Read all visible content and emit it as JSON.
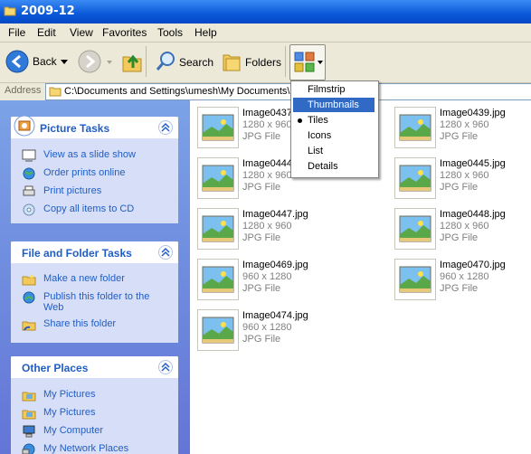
{
  "window": {
    "title": "2009-12"
  },
  "menubar": [
    "File",
    "Edit",
    "View",
    "Favorites",
    "Tools",
    "Help"
  ],
  "toolbar": {
    "back": "Back",
    "search": "Search",
    "folders": "Folders"
  },
  "address": {
    "label": "Address",
    "value": "C:\\Documents and Settings\\umesh\\My Documents\\My"
  },
  "views_menu": {
    "items": [
      "Filmstrip",
      "Thumbnails",
      "Tiles",
      "Icons",
      "List",
      "Details"
    ],
    "highlighted": "Thumbnails",
    "checked": "Tiles"
  },
  "tasks": {
    "picture": {
      "title": "Picture Tasks",
      "items": [
        "View as a slide show",
        "Order prints online",
        "Print pictures",
        "Copy all items to CD"
      ]
    },
    "folder": {
      "title": "File and Folder Tasks",
      "items": [
        "Make a new folder",
        "Publish this folder to the",
        "Web",
        "Share this folder"
      ]
    },
    "places": {
      "title": "Other Places",
      "items": [
        "My Pictures",
        "My Pictures",
        "My Computer",
        "My Network Places"
      ]
    }
  },
  "files": [
    {
      "name": "Image0437.jpg",
      "dim": "1280 x 960",
      "type": "JPG File"
    },
    {
      "name": "Image0439.jpg",
      "dim": "1280 x 960",
      "type": "JPG File"
    },
    {
      "name": "Image0444.jpg",
      "dim": "1280 x 960",
      "type": "JPG File"
    },
    {
      "name": "Image0445.jpg",
      "dim": "1280 x 960",
      "type": "JPG File"
    },
    {
      "name": "Image0447.jpg",
      "dim": "1280 x 960",
      "type": "JPG File"
    },
    {
      "name": "Image0448.jpg",
      "dim": "1280 x 960",
      "type": "JPG File"
    },
    {
      "name": "Image0469.jpg",
      "dim": "960 x 1280",
      "type": "JPG File"
    },
    {
      "name": "Image0470.jpg",
      "dim": "960 x 1280",
      "type": "JPG File"
    },
    {
      "name": "Image0474.jpg",
      "dim": "960 x 1280",
      "type": "JPG File"
    }
  ],
  "colors": {
    "titlebar": "#0a58d8",
    "taskpane": "#6f8fe0",
    "link": "#215dc6",
    "selection": "#316ac5"
  }
}
